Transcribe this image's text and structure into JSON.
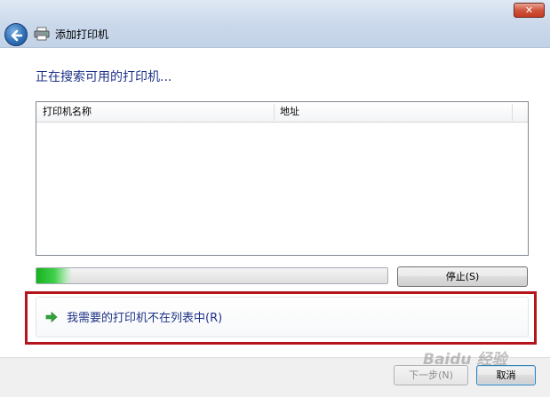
{
  "window": {
    "title": "添加打印机",
    "close_label": "✕"
  },
  "main": {
    "heading": "正在搜索可用的打印机...",
    "list_columns": [
      "打印机名称",
      "地址"
    ],
    "progress_fraction": 0.1,
    "stop_label": "停止(S)",
    "option_label": "我需要的打印机不在列表中(R)"
  },
  "footer": {
    "next_label": "下一步(N)",
    "cancel_label": "取消"
  },
  "watermark": "Baidu 经验",
  "colors": {
    "heading": "#1e3287",
    "highlight_border": "#b5141c",
    "progress": "#16b21f"
  }
}
